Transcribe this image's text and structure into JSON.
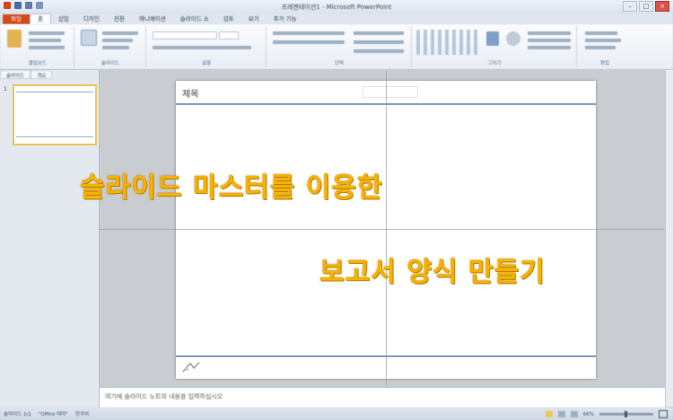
{
  "app": {
    "window_title": "프레젠테이션1 - Microsoft PowerPoint"
  },
  "ribbon": {
    "tabs": [
      {
        "label": "파일"
      },
      {
        "label": "홈"
      },
      {
        "label": "삽입"
      },
      {
        "label": "디자인"
      },
      {
        "label": "전환"
      },
      {
        "label": "애니메이션"
      },
      {
        "label": "슬라이드 쇼"
      },
      {
        "label": "검토"
      },
      {
        "label": "보기"
      },
      {
        "label": "추가 기능"
      }
    ],
    "groups": [
      {
        "label": "클립보드"
      },
      {
        "label": "슬라이드"
      },
      {
        "label": "글꼴"
      },
      {
        "label": "단락"
      },
      {
        "label": "그리기"
      },
      {
        "label": "편집"
      }
    ]
  },
  "left_pane": {
    "tabs": [
      "슬라이드",
      "개요"
    ],
    "slide_number": "1"
  },
  "slide": {
    "title_placeholder": "제목"
  },
  "overlay": {
    "line1": "슬라이드 마스터를 이용한",
    "line2": "보고서 양식 만들기"
  },
  "notes": {
    "placeholder": "여기에 슬라이드 노트의 내용을 입력하십시오"
  },
  "status": {
    "slide_info": "슬라이드 1/1",
    "theme": "\"Office 테마\"",
    "language": "한국어",
    "zoom": "66%"
  },
  "colors": {
    "overlay_text": "#f6b100",
    "file_tab": "#d04a1f",
    "guide_line": "#7e9fc9"
  }
}
